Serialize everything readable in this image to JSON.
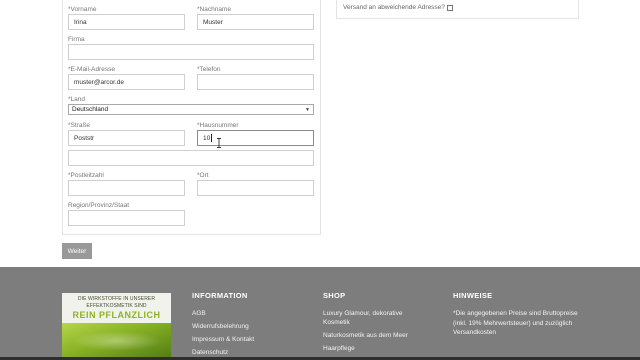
{
  "form": {
    "vorname_label": "*Vorname",
    "vorname_value": "Irina",
    "nachname_label": "*Nachname",
    "nachname_value": "Muster",
    "firma_label": "Firma",
    "firma_value": "",
    "email_label": "*E-Mail-Adresse",
    "email_value": "muster@arcor.de",
    "telefon_label": "*Telefon",
    "telefon_value": "",
    "land_label": "*Land",
    "land_value": "Deutschland",
    "strasse_label": "*Straße",
    "strasse_value": "Poststr",
    "hausnummer_label": "*Hausnummer",
    "hausnummer_value": "10",
    "zusatz_value": "",
    "plz_label": "*Postleitzahl",
    "plz_value": "",
    "ort_label": "*Ort",
    "ort_value": "",
    "region_label": "Region/Provinz/Staat",
    "region_value": ""
  },
  "shipping": {
    "label": "Versand an abweichende Adresse?",
    "checked": false
  },
  "weiter_button": "Weiter",
  "footer": {
    "banner": {
      "line1": "DIE WIRKSTOFFE IN UNSERER",
      "line2": "EFFEKTKOSMETIK SIND",
      "big": "REIN PFLANZLICH"
    },
    "information": {
      "heading": "INFORMATION",
      "items": [
        "AGB",
        "Widerrufsbelehrung",
        "Impressum & Kontakt",
        "Datenschutz"
      ]
    },
    "shop": {
      "heading": "SHOP",
      "items": [
        "Luxury Glamour, dekorative Kosmetik",
        "Naturkosmetik aus dem Meer",
        "Haarpflege"
      ]
    },
    "hinweise": {
      "heading": "HINWEISE",
      "text": "*Die angegebenen Preise sind Bruttopreise (inkl. 19% Mehrwertsteuer) und zuzüglich Versandkosten"
    }
  }
}
